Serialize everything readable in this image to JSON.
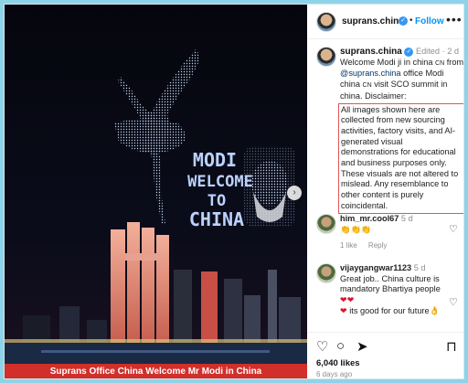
{
  "media": {
    "caption": "Suprans Office China Welcome Mr Modi in China",
    "drone_text": [
      "MODI",
      "WELCOME",
      "TO",
      "CHINA"
    ]
  },
  "header": {
    "username": "suprans.china",
    "separator": "•",
    "follow": "Follow",
    "more": "•••"
  },
  "post": {
    "username": "suprans.china",
    "edited": "Edited",
    "time": "2 d",
    "line1": "Welcome Modi ji in china",
    "flag1": "CN",
    "from": "from",
    "mention": "@suprans.china",
    "office": "office",
    "line2a": "Modi china",
    "flag2": "CN",
    "line2b": "visit SCO summit in china.",
    "disclaimer_label": "Disclaimer:",
    "disclaimer": "All images shown here are collected from new sourcing activities, factory visits, and AI-generated visual demonstrations for educational and business purposes only. These visuals are not altered to mislead. Any resemblance to other content is purely coincidental."
  },
  "comments": [
    {
      "username": "him_mr.cool67",
      "time": "5 d",
      "text": "👏👏👏",
      "likes": "1 like",
      "reply": "Reply"
    },
    {
      "username": "vijaygangwar1123",
      "time": "5 d",
      "text": "Great job.. China culture is mandatory Bhartiya people",
      "text2": "its good for our future",
      "hearts": "❤❤",
      "heart3": "❤",
      "emoji_end": "👌"
    }
  ],
  "actions": {
    "likes": "6,040 likes",
    "ago": "6 days ago"
  },
  "colors": {
    "follow": "#0095f6",
    "caption_bar": "#d12f2a",
    "disclaimer_border": "#e05555"
  }
}
